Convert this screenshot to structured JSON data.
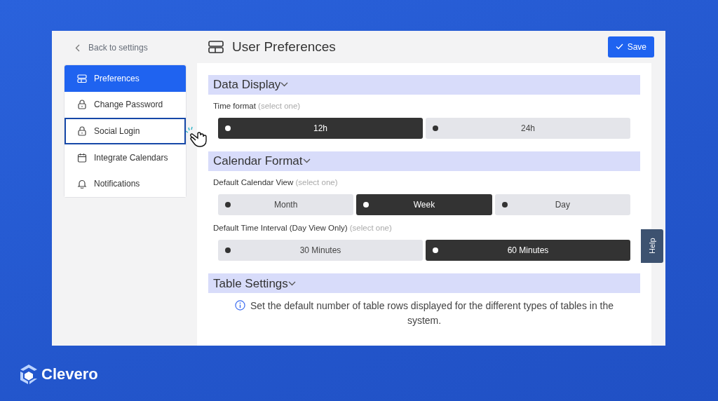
{
  "back_link": "Back to settings",
  "sidebar": {
    "items": [
      {
        "label": "Preferences",
        "kind": "preferences",
        "selected": true,
        "focused": false
      },
      {
        "label": "Change Password",
        "kind": "lock",
        "selected": false,
        "focused": false
      },
      {
        "label": "Social Login",
        "kind": "lock",
        "selected": false,
        "focused": true
      },
      {
        "label": "Integrate Calendars",
        "kind": "calendar",
        "selected": false,
        "focused": false
      },
      {
        "label": "Notifications",
        "kind": "bell",
        "selected": false,
        "focused": false
      }
    ]
  },
  "page_title": "User Preferences",
  "save_button": "Save",
  "sections": [
    {
      "title": "Data Display",
      "fields": [
        {
          "label": "Time format",
          "hint": "(select one)",
          "options": [
            {
              "label": "12h",
              "selected": true
            },
            {
              "label": "24h",
              "selected": false
            }
          ]
        }
      ]
    },
    {
      "title": "Calendar Format",
      "fields": [
        {
          "label": "Default Calendar View",
          "hint": "(select one)",
          "options": [
            {
              "label": "Month",
              "selected": false
            },
            {
              "label": "Week",
              "selected": true
            },
            {
              "label": "Day",
              "selected": false
            }
          ]
        },
        {
          "label": "Default Time Interval (Day View Only)",
          "hint": "(select one)",
          "options": [
            {
              "label": "30 Minutes",
              "selected": false
            },
            {
              "label": "60 Minutes",
              "selected": true
            }
          ]
        }
      ]
    },
    {
      "title": "Table Settings",
      "info": "Set the default number of table rows displayed for the different types of tables in the system."
    }
  ],
  "help_tab": "Help",
  "brand": "Clevero"
}
